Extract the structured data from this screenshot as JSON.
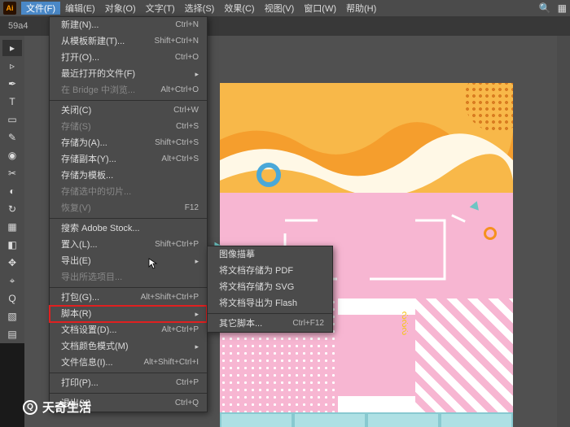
{
  "menubar": {
    "items": [
      "文件(F)",
      "编辑(E)",
      "对象(O)",
      "文字(T)",
      "选择(S)",
      "效果(C)",
      "视图(V)",
      "窗口(W)",
      "帮助(H)"
    ],
    "active_index": 0,
    "logo": "Ai"
  },
  "tab": {
    "label": "59a4"
  },
  "file_menu": {
    "groups": [
      [
        {
          "label": "新建(N)...",
          "shortcut": "Ctrl+N"
        },
        {
          "label": "从模板新建(T)...",
          "shortcut": "Shift+Ctrl+N"
        },
        {
          "label": "打开(O)...",
          "shortcut": "Ctrl+O"
        },
        {
          "label": "最近打开的文件(F)",
          "shortcut": "",
          "submenu": true
        },
        {
          "label": "在 Bridge 中浏览...",
          "shortcut": "Alt+Ctrl+O",
          "disabled": true
        }
      ],
      [
        {
          "label": "关闭(C)",
          "shortcut": "Ctrl+W"
        },
        {
          "label": "存储(S)",
          "shortcut": "Ctrl+S",
          "disabled": true
        },
        {
          "label": "存储为(A)...",
          "shortcut": "Shift+Ctrl+S"
        },
        {
          "label": "存储副本(Y)...",
          "shortcut": "Alt+Ctrl+S"
        },
        {
          "label": "存储为模板...",
          "shortcut": ""
        },
        {
          "label": "存储选中的切片...",
          "shortcut": "",
          "disabled": true
        },
        {
          "label": "恢复(V)",
          "shortcut": "F12",
          "disabled": true
        }
      ],
      [
        {
          "label": "搜索 Adobe Stock...",
          "shortcut": ""
        },
        {
          "label": "置入(L)...",
          "shortcut": "Shift+Ctrl+P"
        },
        {
          "label": "导出(E)",
          "shortcut": "",
          "submenu": true
        },
        {
          "label": "导出所选项目...",
          "shortcut": "",
          "disabled": true
        }
      ],
      [
        {
          "label": "打包(G)...",
          "shortcut": "Alt+Shift+Ctrl+P"
        },
        {
          "label": "脚本(R)",
          "shortcut": "",
          "submenu": true,
          "highlighted": true
        },
        {
          "label": "文档设置(D)...",
          "shortcut": "Alt+Ctrl+P"
        },
        {
          "label": "文档颜色模式(M)",
          "shortcut": "",
          "submenu": true
        },
        {
          "label": "文件信息(I)...",
          "shortcut": "Alt+Shift+Ctrl+I"
        }
      ],
      [
        {
          "label": "打印(P)...",
          "shortcut": "Ctrl+P"
        }
      ],
      [
        {
          "label": "退出(X)",
          "shortcut": "Ctrl+Q"
        }
      ]
    ]
  },
  "script_submenu": {
    "groups": [
      [
        {
          "label": "图像描摹",
          "shortcut": ""
        },
        {
          "label": "将文档存储为 PDF",
          "shortcut": ""
        },
        {
          "label": "将文档存储为 SVG",
          "shortcut": ""
        },
        {
          "label": "将文档导出为 Flash",
          "shortcut": ""
        }
      ],
      [
        {
          "label": "其它脚本...",
          "shortcut": "Ctrl+F12"
        }
      ]
    ]
  },
  "watermark": {
    "text": "天奇生活"
  },
  "tools": [
    "▸",
    "▹",
    "✒",
    "T",
    "▭",
    "✎",
    "◉",
    "✂",
    "◐",
    "↻",
    "▦",
    "◧",
    "✥",
    "⌖",
    "Q",
    "▧",
    "▤"
  ]
}
